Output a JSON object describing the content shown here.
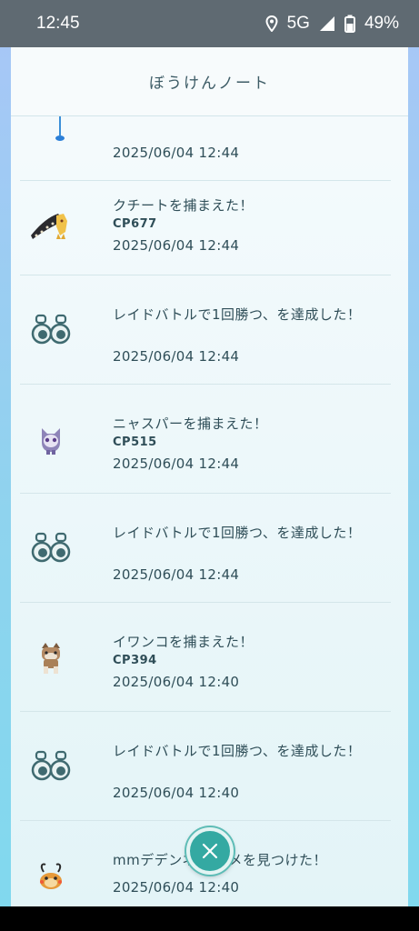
{
  "status_bar": {
    "time": "12:45",
    "network": "5G",
    "battery": "49%"
  },
  "header": {
    "title": "ぼうけんノート"
  },
  "entries": [
    {
      "title": "",
      "cp": "",
      "time": "2025/06/04 12:44",
      "icon": "partial-entry"
    },
    {
      "title": "クチートを捕まえた！",
      "cp": "CP677",
      "time": "2025/06/04 12:44",
      "icon": "mawile-icon"
    },
    {
      "title": "レイドバトルで1回勝つ、を達成した！",
      "cp": "",
      "time": "2025/06/04 12:44",
      "icon": "binoculars-icon"
    },
    {
      "title": "ニャスパーを捕まえた！",
      "cp": "CP515",
      "time": "2025/06/04 12:44",
      "icon": "espurr-icon"
    },
    {
      "title": "レイドバトルで1回勝つ、を達成した！",
      "cp": "",
      "time": "2025/06/04 12:44",
      "icon": "binoculars-icon"
    },
    {
      "title": "イワンコを捕まえた！",
      "cp": "CP394",
      "time": "2025/06/04 12:40",
      "icon": "rockruff-icon"
    },
    {
      "title": "レイドバトルで1回勝つ、を達成した！",
      "cp": "",
      "time": "2025/06/04 12:40",
      "icon": "binoculars-icon"
    },
    {
      "title": "mmデデンネ がアメを見つけた！",
      "cp": "",
      "time": "2025/06/04 12:40",
      "icon": "dedenne-icon"
    }
  ],
  "colors": {
    "accent": "#34a9a2",
    "text": "#2f4e58"
  }
}
